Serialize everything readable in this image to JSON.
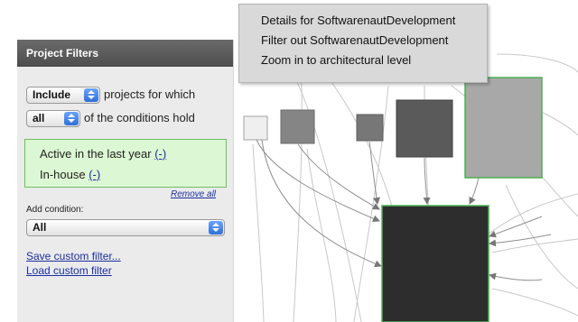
{
  "panel": {
    "title": "Project Filters",
    "include_select": "Include",
    "include_suffix": "projects for which",
    "quantifier_select": "all",
    "quantifier_suffix": "of the conditions hold",
    "conditions": [
      {
        "label": "Active in the last year",
        "remove": "(-)"
      },
      {
        "label": "In-house",
        "remove": "(-)"
      }
    ],
    "remove_all": "Remove all",
    "add_condition_label": "Add condition:",
    "add_condition_select": "All",
    "save_link": "Save custom filter...",
    "load_link": "Load custom filter"
  },
  "context_menu": {
    "items": [
      "Details for SoftwarenautDevelopment",
      "Filter out SoftwarenautDevelopment",
      "Zoom in to architectural level"
    ]
  },
  "colors": {
    "panel_header": "#555555",
    "conditions_bg": "#dcf7d3",
    "link": "#1a2ea0",
    "highlight_border": "#4caf50",
    "node_dark": "#2d2d2d",
    "node_mid": "#5a5a5a",
    "node_gray": "#858585",
    "node_light": "#a8a8a8",
    "node_pale": "#efefef"
  }
}
